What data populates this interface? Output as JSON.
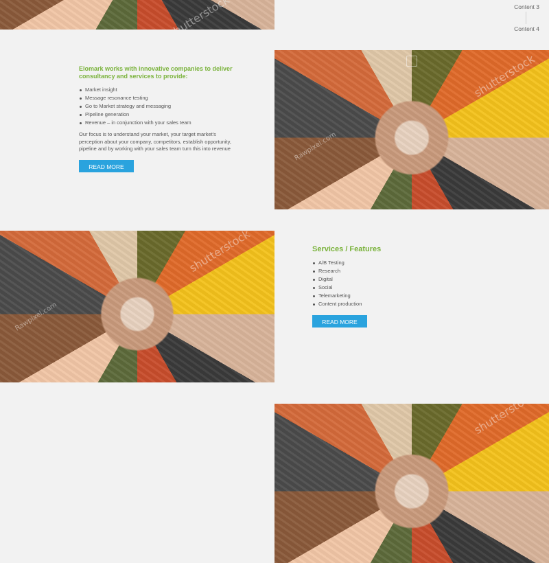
{
  "side_nav": {
    "items": [
      "Content 3",
      "Content 4"
    ]
  },
  "section_one": {
    "headline": "Elomark works with innovative companies to deliver consultancy and services to provide:",
    "bullets": [
      "Market insight",
      "Message resonance testing",
      "Go to Market strategy and messaging",
      "Pipeline generation",
      "Revenue – in conjunction with your sales team"
    ],
    "paragraph": "Our focus is to understand your market, your target market's perception about your company, competitors, establish opportunity, pipeline and by working with your sales team turn this into revenue",
    "button_label": "READ MORE"
  },
  "section_two": {
    "headline": "Services / Features",
    "bullets": [
      "A/B Testing",
      "Research",
      "Digital",
      "Social",
      "Telemarketing",
      "Content production"
    ],
    "button_label": "READ MORE"
  },
  "watermarks": {
    "stock": "shutterstock",
    "rawpixel": "Rawpixel.com"
  },
  "colors": {
    "accent_green": "#79b23a",
    "button_blue": "#2aa3de",
    "background": "#f2f2f2"
  },
  "icons": {
    "photo": "team-hands-photo"
  }
}
